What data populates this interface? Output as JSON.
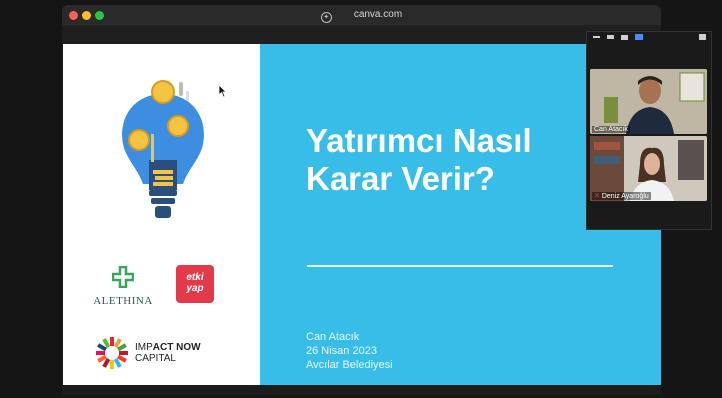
{
  "browser": {
    "url": "canva.com"
  },
  "slide": {
    "title_line1": "Yatırımcı Nasıl",
    "title_line2": "Karar Verir?",
    "presenter": "Can Atacık",
    "date": "26 Nisan 2023",
    "venue": "Avcılar Belediyesi",
    "logos": {
      "alethina": "ALETHINA",
      "etki_line1": "etki",
      "etki_line2": "yap",
      "impact_line1_a": "IMP",
      "impact_line1_b": "ACT NOW",
      "impact_line2": "CAPITAL"
    }
  },
  "meeting": {
    "participants": [
      {
        "name": "Can Atacık"
      },
      {
        "name": "Deniz Ayaroğlu"
      }
    ]
  },
  "colors": {
    "slide_blue": "#38bde9",
    "bulb_blue": "#3d8ee0",
    "coin_yellow": "#f6c443"
  }
}
